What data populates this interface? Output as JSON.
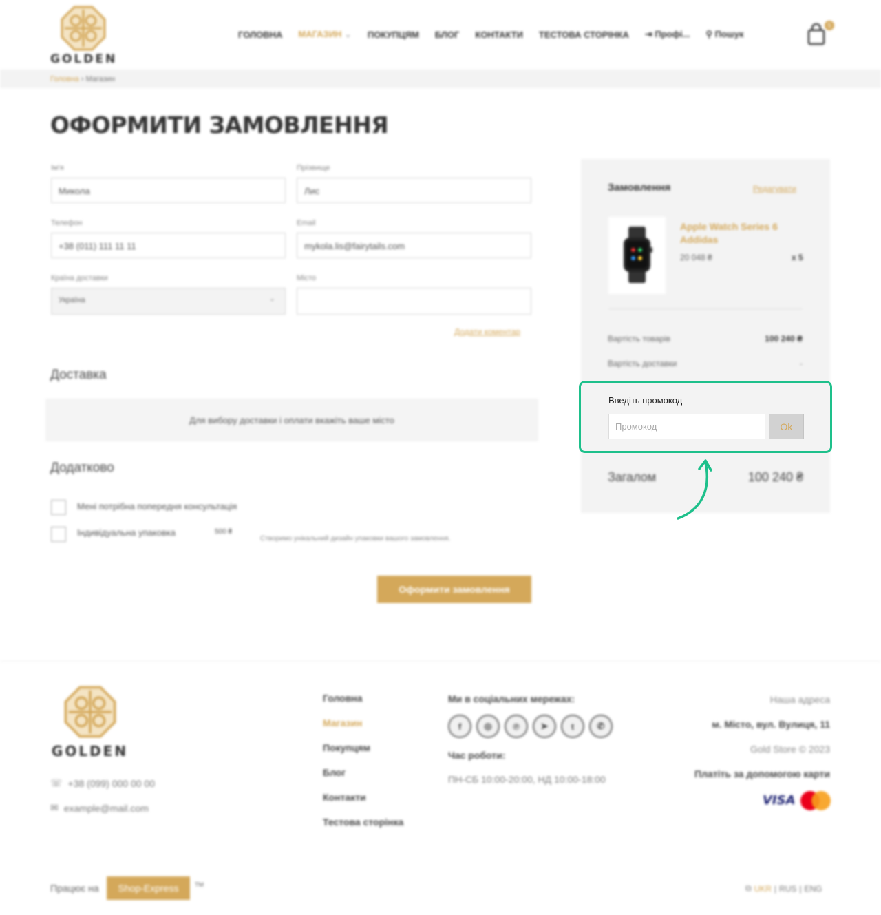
{
  "brand": {
    "name": "GOLDEN",
    "accent": "#d4a85a",
    "highlight": "#1ec08b"
  },
  "nav": {
    "items": [
      "ГОЛОВНА",
      "МАГАЗИН",
      "ПОКУПЦЯМ",
      "БЛОГ",
      "КОНТАКТИ",
      "ТЕСТОВА СТОРІНКА"
    ],
    "profile": "Профі...",
    "search": "Пошук",
    "cart_count": "5"
  },
  "breadcrumbs": {
    "home": "Головна",
    "sep": "›",
    "current": "Магазин"
  },
  "page_title": "ОФОРМИТИ ЗАМОВЛЕННЯ",
  "form": {
    "first_name": {
      "label": "Ім'я",
      "value": "Микола"
    },
    "last_name": {
      "label": "Прізвище",
      "value": "Лис"
    },
    "phone": {
      "label": "Телефон",
      "value": "+38 (011) 111 11 11"
    },
    "email": {
      "label": "Email",
      "value": "mykola.lis@fairytails.com"
    },
    "country": {
      "label": "Країна доставки",
      "value": "Україна"
    },
    "city": {
      "label": "Місто",
      "value": ""
    },
    "add_comment": "Додати коментар"
  },
  "delivery": {
    "title": "Доставка",
    "hint": "Для вибору доставки і оплати вкажіть ваше місто"
  },
  "extra": {
    "title": "Додатково",
    "consult": "Мені потрібна попередня консультація",
    "packaging": "Індивідуальна упаковка",
    "packaging_price": "500 ₴",
    "packaging_note": "Створимо унікальний дизайн упаковки вашого замовлення."
  },
  "submit_label": "Оформити замовлення",
  "order": {
    "title": "Замовлення",
    "edit": "Редагувати",
    "product": {
      "name": "Apple Watch Series 6 Addidas",
      "price": "20 048 ₴",
      "qty": "x 5"
    },
    "goods_label": "Вартість товарів",
    "goods_value": "100 240 ₴",
    "shipping_label": "Вартість доставки",
    "shipping_value": "-",
    "promo_label": "Введіть промокод",
    "promo_placeholder": "Промокод",
    "promo_button": "Ok",
    "total_label": "Загалом",
    "total_value": "100 240 ₴"
  },
  "footer": {
    "brand": "GOLDEN",
    "phone": "+38 (099) 000 00 00",
    "email": "example@mail.com",
    "menu": [
      "Головна",
      "Магазин",
      "Покупцям",
      "Блог",
      "Контакти",
      "Тестова сторінка"
    ],
    "social_title": "Ми в соціальних мережах:",
    "socials": [
      "facebook-icon",
      "instagram-icon",
      "pinterest-icon",
      "telegram-icon",
      "twitter-icon",
      "whatsapp-icon"
    ],
    "hours_title": "Час роботи:",
    "hours": "ПН-СБ 10:00-20:00, НД 10:00-18:00",
    "address_title": "Наша адреса",
    "address": "м. Місто, вул. Вулиця, 11",
    "copyright": "Gold Store © 2023",
    "pay_title": "Платіть за допомогою карти",
    "visa": "VISA",
    "powered_prefix": "Працює на",
    "powered_brand": "Shop-Express",
    "tm": "TM",
    "langs": [
      "UKR",
      "RUS",
      "ENG"
    ]
  }
}
